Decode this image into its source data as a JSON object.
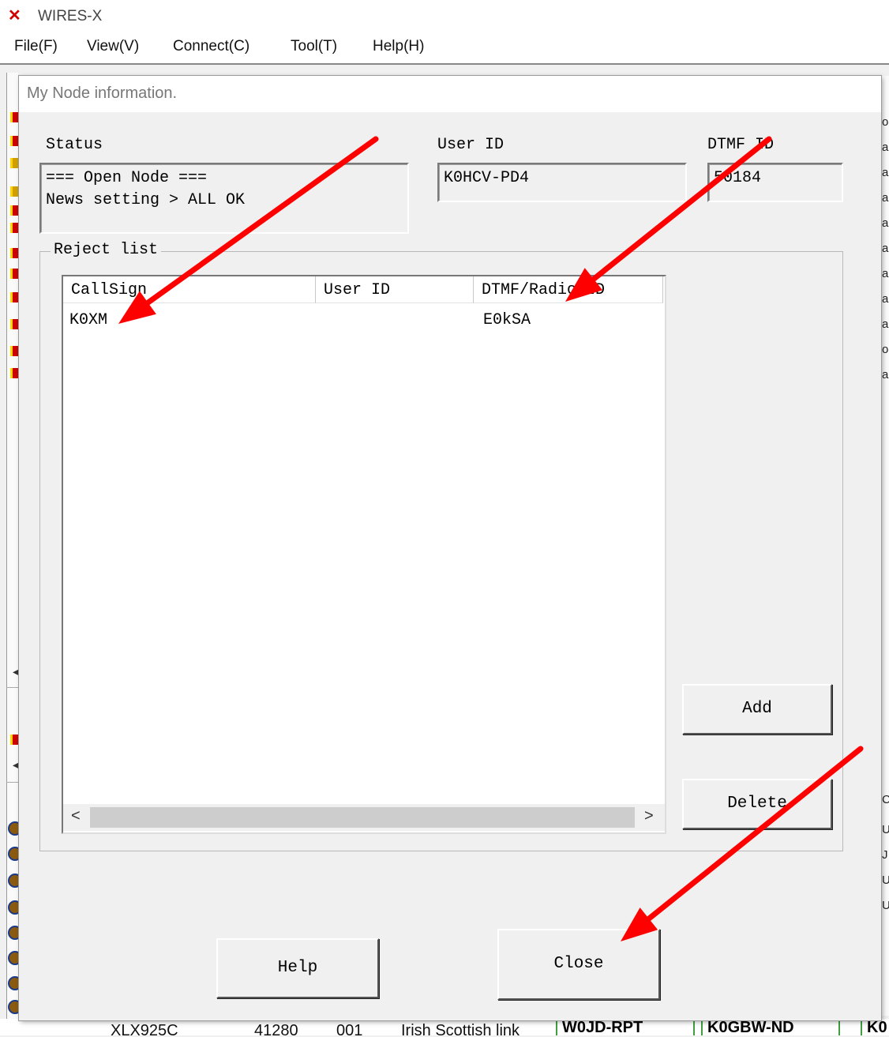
{
  "app": {
    "title": "WIRES-X",
    "icon": "x-logo-icon",
    "menu": [
      "File(F)",
      "View(V)",
      "Connect(C)",
      "Tool(T)",
      "Help(H)"
    ]
  },
  "background_peek": {
    "row": [
      "XLX925C",
      "41280",
      "001",
      "Irish Scottish link"
    ],
    "nodes": [
      "W0JD-RPT",
      "K0GBW-ND",
      "K0"
    ],
    "right_strip_chars": [
      "o",
      "a",
      "a",
      "a",
      "a",
      "a",
      "a",
      "a",
      "a",
      "o",
      "a",
      "C",
      "U",
      "J",
      "U",
      "U"
    ]
  },
  "dialog": {
    "title": "My Node information.",
    "status": {
      "label": "Status",
      "line1": "=== Open Node ===",
      "line2": "News setting > ALL OK"
    },
    "user_id": {
      "label": "User ID",
      "value": "K0HCV-PD4"
    },
    "dtmf_id": {
      "label": "DTMF ID",
      "value": "50184"
    },
    "reject_list": {
      "label": "Reject list",
      "columns": [
        "CallSign",
        "User ID",
        "DTMF/Radio ID"
      ],
      "rows": [
        {
          "callsign": "K0XM",
          "user_id": "",
          "dtmf": "E0kSA"
        }
      ]
    },
    "buttons": {
      "add": "Add",
      "delete": "Delete",
      "help": "Help",
      "close": "Close"
    }
  },
  "annotations": {
    "arrow_color": "#ff0000"
  }
}
